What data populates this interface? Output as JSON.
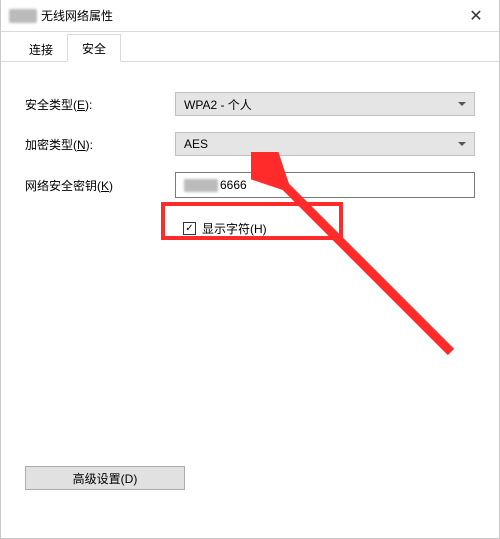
{
  "window": {
    "title_suffix": "无线网络属性",
    "close_glyph": "✕"
  },
  "tabs": {
    "t0": "连接",
    "t1": "安全"
  },
  "labels": {
    "securityType_pre": "安全类型(",
    "securityType_u": "E",
    "securityType_post": "):",
    "encryptType_pre": "加密类型(",
    "encryptType_u": "N",
    "encryptType_post": "):",
    "netKey_pre": "网络安全密钥(",
    "netKey_u": "K",
    "netKey_post": ")",
    "showChars_pre": "显示字符(",
    "showChars_u": "H",
    "showChars_post": ")",
    "advanced_pre": "高级设置(",
    "advanced_u": "D",
    "advanced_post": ")"
  },
  "values": {
    "securityType": "WPA2 - 个人",
    "encryptType": "AES",
    "netKeyVisible": "6666",
    "showCharsCheck": "✓"
  }
}
